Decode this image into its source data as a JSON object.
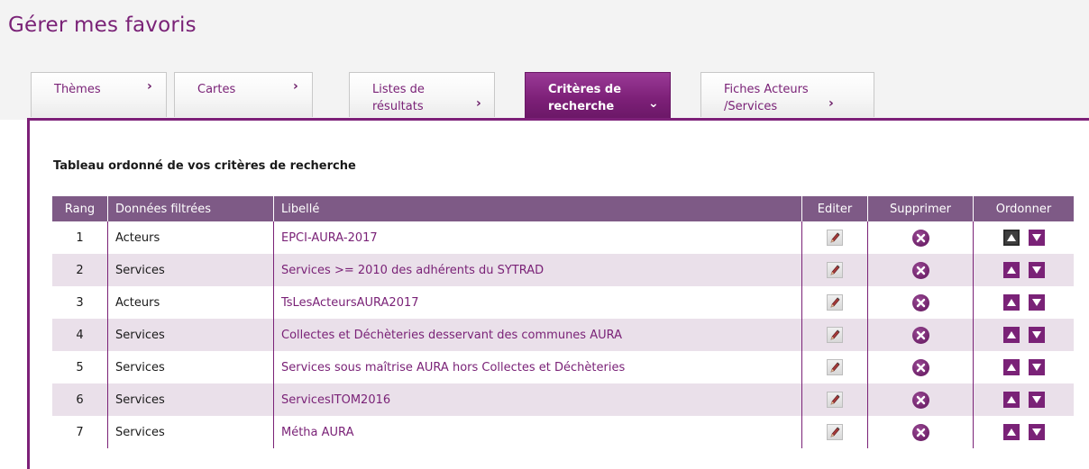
{
  "page_title": "Gérer mes favoris",
  "tabs": [
    {
      "label_lines": [
        "Thèmes"
      ],
      "arrow": "›",
      "active": false
    },
    {
      "label_lines": [
        "Cartes"
      ],
      "arrow": "›",
      "active": false
    },
    {
      "label_lines": [
        "Listes de",
        "résultats"
      ],
      "arrow": "›",
      "active": false
    },
    {
      "label_lines": [
        "Critères de",
        "recherche"
      ],
      "arrow": "⌄",
      "active": true
    },
    {
      "label_lines": [
        "Fiches Acteurs",
        "/Services"
      ],
      "arrow": "›",
      "active": false
    }
  ],
  "caption": "Tableau ordonné de vos critères de recherche",
  "columns": {
    "rang": "Rang",
    "donnees": "Données filtrées",
    "libelle": "Libellé",
    "editer": "Editer",
    "supprimer": "Supprimer",
    "ordonner": "Ordonner"
  },
  "rows": [
    {
      "rang": "1",
      "donnees": "Acteurs",
      "libelle": "EPCI-AURA-2017"
    },
    {
      "rang": "2",
      "donnees": "Services",
      "libelle": "Services >= 2010 des adhérents du SYTRAD"
    },
    {
      "rang": "3",
      "donnees": "Acteurs",
      "libelle": "TsLesActeursAURA2017"
    },
    {
      "rang": "4",
      "donnees": "Services",
      "libelle": "Collectes et Déchèteries desservant des communes AURA"
    },
    {
      "rang": "5",
      "donnees": "Services",
      "libelle": "Services sous maîtrise AURA hors Collectes et Déchèteries"
    },
    {
      "rang": "6",
      "donnees": "Services",
      "libelle": "ServicesITOM2016"
    },
    {
      "rang": "7",
      "donnees": "Services",
      "libelle": "Métha AURA"
    }
  ],
  "icons": {
    "edit": "pencil-icon",
    "delete": "delete-icon",
    "up": "arrow-up-icon",
    "down": "arrow-down-icon"
  },
  "colors": {
    "accent": "#7a2277",
    "header_bg": "#7e5a86",
    "alt_row": "#eae0ea"
  }
}
